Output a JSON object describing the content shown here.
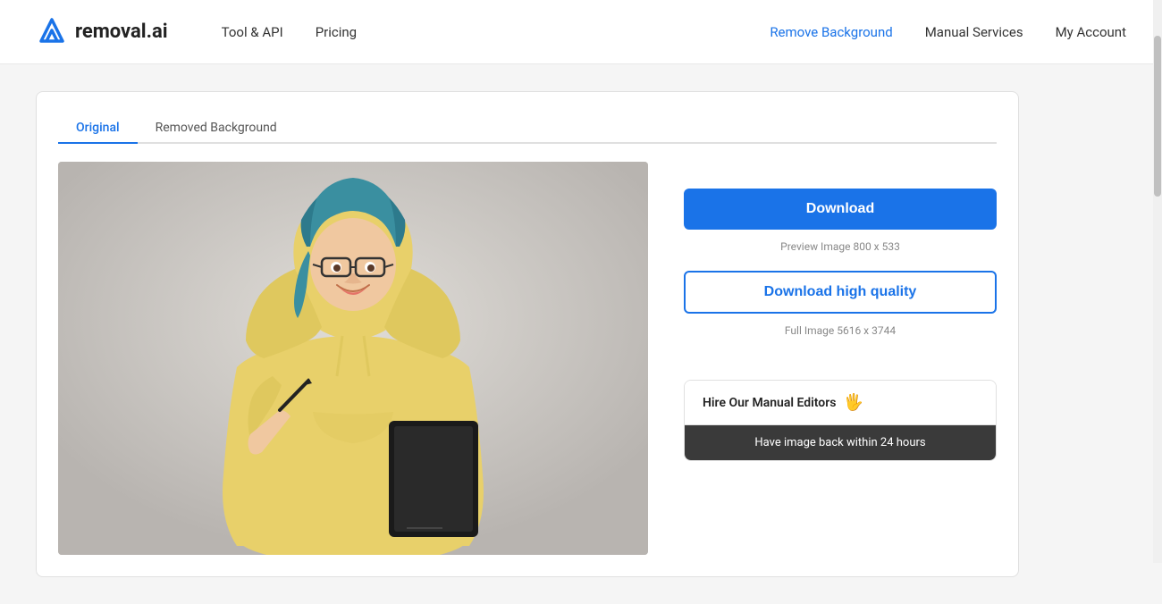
{
  "header": {
    "logo_text": "removal.ai",
    "nav_left": [
      {
        "label": "Tool & API",
        "id": "tool-api"
      },
      {
        "label": "Pricing",
        "id": "pricing"
      }
    ],
    "nav_right": [
      {
        "label": "Remove Background",
        "id": "remove-bg",
        "highlighted": true
      },
      {
        "label": "Manual Services",
        "id": "manual-services"
      },
      {
        "label": "My Account",
        "id": "my-account"
      }
    ]
  },
  "tabs": [
    {
      "label": "Original",
      "active": true
    },
    {
      "label": "Removed Background",
      "active": false
    }
  ],
  "right_panel": {
    "download_btn": "Download",
    "preview_label": "Preview Image  800 x 533",
    "download_hq_btn": "Download high quality",
    "full_label": "Full Image  5616 x 3744",
    "hire_editors_title": "Hire Our Manual Editors",
    "hire_editors_emoji": "🖐",
    "hire_editors_subtitle": "Have image back within 24 hours"
  }
}
